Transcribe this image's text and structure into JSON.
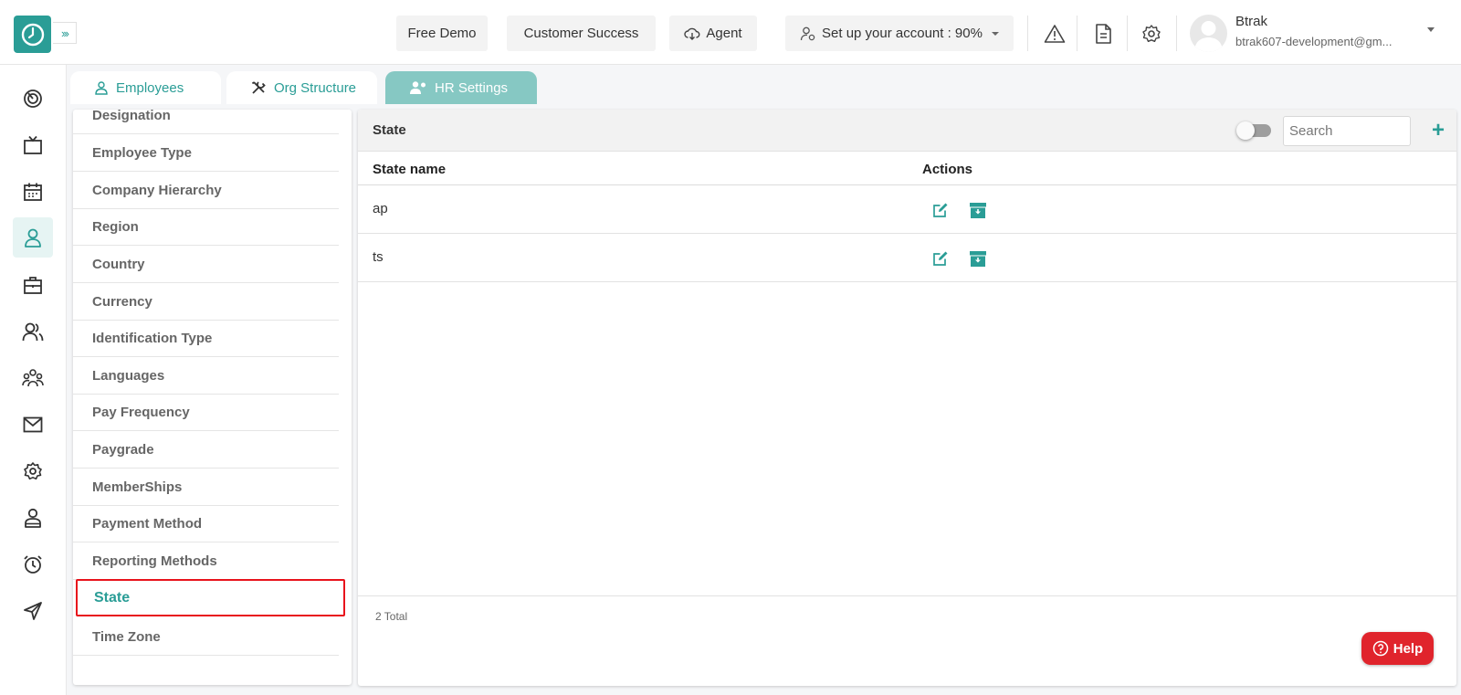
{
  "topbar": {
    "free_demo": "Free Demo",
    "customer_success": "Customer Success",
    "agent": "Agent",
    "setup": "Set up your account : 90%",
    "setup_progress": 0.9,
    "user_name": "Btrak",
    "user_email": "btrak607-development@gm..."
  },
  "tabs": [
    {
      "label": "Employees",
      "icon": "user-icon"
    },
    {
      "label": "Org Structure",
      "icon": "tools-icon"
    },
    {
      "label": "HR Settings",
      "icon": "users-gear-icon",
      "active": true
    }
  ],
  "rail_icons": [
    "dashboard-icon",
    "tv-icon",
    "calendar-icon",
    "user-icon",
    "briefcase-icon",
    "users-icon",
    "team-icon",
    "mail-icon",
    "gear-icon",
    "profile-icon",
    "alarm-icon",
    "send-icon"
  ],
  "settings_menu": [
    {
      "label": "Designation"
    },
    {
      "label": "Employee Type"
    },
    {
      "label": "Company Hierarchy"
    },
    {
      "label": "Region"
    },
    {
      "label": "Country"
    },
    {
      "label": "Currency"
    },
    {
      "label": "Identification Type"
    },
    {
      "label": "Languages"
    },
    {
      "label": "Pay Frequency"
    },
    {
      "label": "Paygrade"
    },
    {
      "label": "MemberShips"
    },
    {
      "label": "Payment Method"
    },
    {
      "label": "Reporting Methods"
    },
    {
      "label": "State",
      "active": true
    },
    {
      "label": "Time Zone"
    }
  ],
  "panel": {
    "title": "State",
    "search_placeholder": "Search",
    "columns": [
      "State name",
      "Actions"
    ],
    "rows": [
      {
        "name": "ap"
      },
      {
        "name": "ts"
      }
    ],
    "total": "2 Total"
  },
  "help_label": "Help",
  "colors": {
    "accent": "#2a9d96",
    "tab_active": "#86c8c3",
    "highlight": "#e8131c",
    "help": "#e0242c"
  }
}
